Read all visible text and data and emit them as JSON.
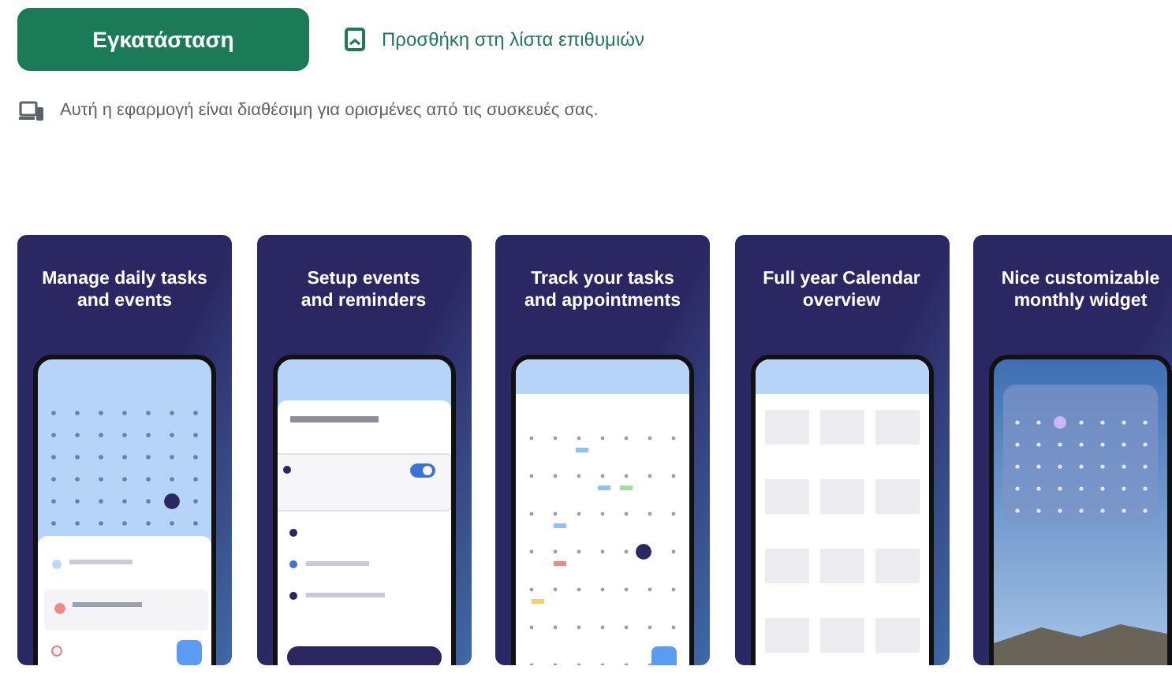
{
  "install_button": {
    "label": "Εγκατάσταση"
  },
  "wishlist_link": {
    "label": "Προσθήκη στη λίστα επιθυμιών"
  },
  "availability_note": {
    "text": "Αυτή η εφαρμογή είναι διαθέσιμη για ορισμένες από τις συσκευές σας."
  },
  "screenshots": [
    {
      "caption": "Manage daily tasks and events",
      "kind": "calendar"
    },
    {
      "caption": "Setup events and reminders",
      "kind": "form"
    },
    {
      "caption": "Track your tasks and appointments",
      "kind": "month"
    },
    {
      "caption": "Full year Calendar overview",
      "kind": "year"
    },
    {
      "caption": "Nice customizable monthly widget",
      "kind": "widget"
    }
  ]
}
